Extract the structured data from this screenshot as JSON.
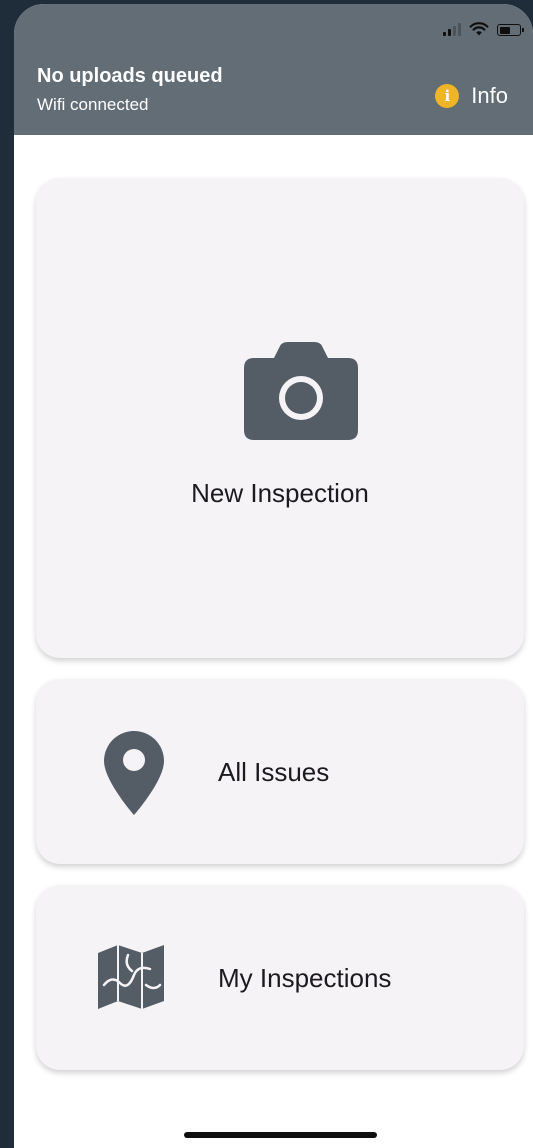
{
  "header": {
    "title": "No uploads queued",
    "subtitle": "Wifi connected",
    "info_label": "Info",
    "info_icon_glyph": "i",
    "background_color": "#626d76",
    "info_icon_color": "#f0b429"
  },
  "cards": {
    "new_inspection": {
      "label": "New Inspection",
      "icon": "camera-icon"
    },
    "all_issues": {
      "label": "All Issues",
      "icon": "map-pin-icon"
    },
    "my_inspections": {
      "label": "My Inspections",
      "icon": "map-icon"
    }
  },
  "colors": {
    "card_background": "#f5f3f6",
    "icon_color": "#545c66",
    "text_color": "#1b1b1f"
  }
}
